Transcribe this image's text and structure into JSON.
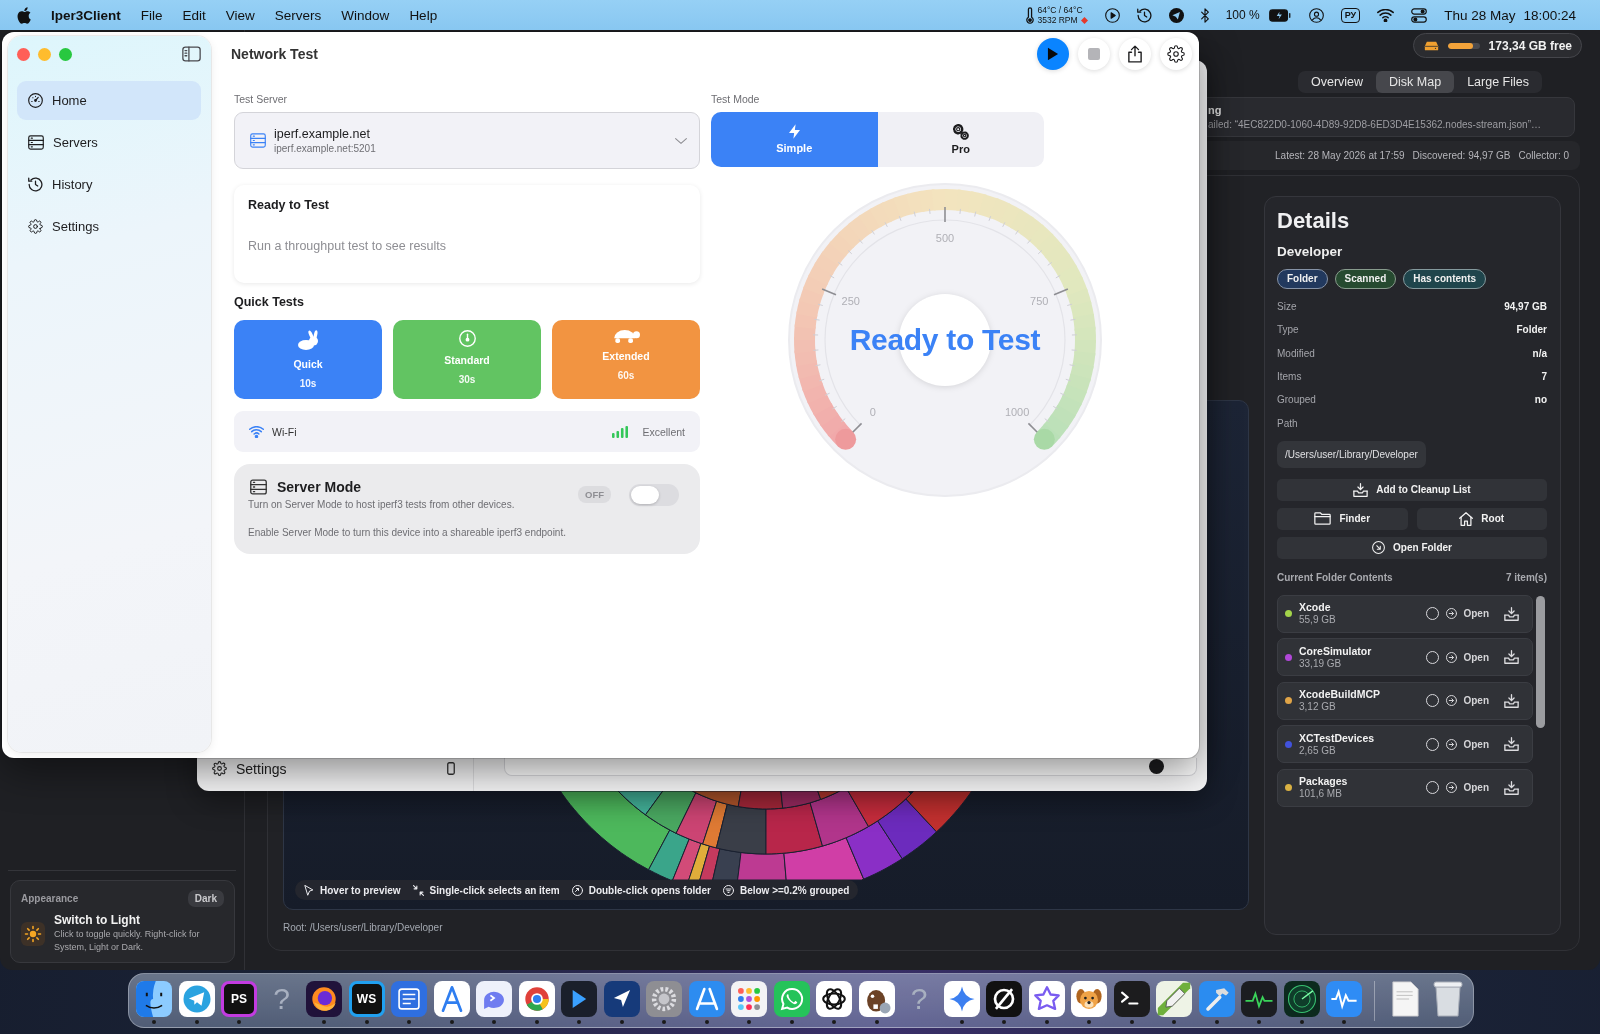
{
  "menu_bar": {
    "app_name": "Iper3Client",
    "menus": [
      "File",
      "Edit",
      "View",
      "Servers",
      "Window",
      "Help"
    ],
    "temperature": "64°C / 64°C",
    "fan_speed": "3532 RPM",
    "battery": "100 %",
    "input_source": "РУ",
    "date": "Thu 28 May",
    "time": "18:00:24"
  },
  "window": {
    "title": "Network Test"
  },
  "sidebar": {
    "items": [
      {
        "label": "Home",
        "kind": "gauge",
        "selected": true
      },
      {
        "label": "Servers",
        "kind": "servers",
        "selected": false
      },
      {
        "label": "History",
        "kind": "history",
        "selected": false
      },
      {
        "label": "Settings",
        "kind": "settings",
        "selected": false
      }
    ]
  },
  "toolbar": {
    "buttons": [
      {
        "kind": "start",
        "disabled": false
      },
      {
        "kind": "stop",
        "disabled": true
      },
      {
        "kind": "share",
        "disabled": false
      },
      {
        "kind": "settings",
        "disabled": false
      }
    ]
  },
  "test_server": {
    "label": "Test Server",
    "name": "iperf.example.net",
    "address": "iperf.example.net:5201"
  },
  "status_card": {
    "title": "Ready to Test",
    "message": "Run a throughput test to see results"
  },
  "quick_tests": {
    "title": "Quick Tests",
    "tests": [
      {
        "name": "Quick",
        "duration": "10s",
        "kind": "rabbit",
        "color": "#3b82f6"
      },
      {
        "name": "Standard",
        "duration": "30s",
        "kind": "gauge",
        "color": "#62c462"
      },
      {
        "name": "Extended",
        "duration": "60s",
        "kind": "turtle",
        "color": "#f29441"
      }
    ]
  },
  "connection": {
    "type": "Wi-Fi",
    "quality": "Excellent"
  },
  "server_mode": {
    "title": "Server Mode",
    "description": "Turn on Server Mode to host iperf3 tests from other devices.",
    "state": "OFF",
    "on": false,
    "note": "Enable Server Mode to turn this device into a shareable iperf3 endpoint."
  },
  "test_mode": {
    "label": "Test Mode",
    "options": [
      {
        "label": "Simple",
        "kind": "bolt",
        "selected": true
      },
      {
        "label": "Pro",
        "kind": "gears",
        "selected": false
      }
    ]
  },
  "gauge": {
    "ticks": [
      "0",
      "250",
      "500",
      "750",
      "1000"
    ],
    "status": "Ready to Test"
  },
  "settings_window": {
    "sidebar_item": "Settings"
  },
  "disk_app": {
    "free_space": {
      "text": "173,34 GB free",
      "level": 0.8
    },
    "tabs": [
      {
        "label": "Overview",
        "selected": false
      },
      {
        "label": "Disk Map",
        "selected": true
      },
      {
        "label": "Large Files",
        "selected": false
      }
    ],
    "error_banner": {
      "title": "ng",
      "message": "ailed: “4EC822D0-1060-4D89-92D8-6ED3D4E15362.nodes-stream.json”…"
    },
    "scan_stats": [
      "Latest: 28 May 2026 at 17:59",
      "Discovered: 94,97 GB",
      "Collector: 0"
    ],
    "hints": [
      {
        "kind": "pointer",
        "text": "Hover to preview"
      },
      {
        "kind": "select",
        "text": "Single-click selects an item"
      },
      {
        "kind": "open",
        "text": "Double-click opens folder"
      },
      {
        "kind": "group",
        "text": "Below >=0.2% grouped"
      }
    ],
    "root_path": "Root: /Users/user/Library/Developer",
    "details": {
      "title": "Details",
      "name": "Developer",
      "tags": [
        {
          "label": "Folder",
          "color": "#22395e"
        },
        {
          "label": "Scanned",
          "color": "#264a30"
        },
        {
          "label": "Has contents",
          "color": "#1f454c"
        }
      ],
      "properties": [
        {
          "label": "Size",
          "value": "94,97 GB"
        },
        {
          "label": "Type",
          "value": "Folder"
        },
        {
          "label": "Modified",
          "value": "n/a"
        },
        {
          "label": "Items",
          "value": "7"
        },
        {
          "label": "Grouped",
          "value": "no"
        }
      ],
      "path_label": "Path",
      "path": "/Users/user/Library/Developer",
      "actions": [
        {
          "label": "Add to Cleanup List",
          "kind": "cleanup"
        },
        {
          "label": "Finder",
          "kind": "finder"
        },
        {
          "label": "Root",
          "kind": "root"
        },
        {
          "label": "Open Folder",
          "kind": "open"
        }
      ],
      "contents_title": "Current Folder Contents",
      "contents_count": "7 item(s)",
      "contents": [
        {
          "name": "Xcode",
          "size": "55,9 GB",
          "color": "#a3d44a",
          "checked": false,
          "action": "Open"
        },
        {
          "name": "CoreSimulator",
          "size": "33,19 GB",
          "color": "#b147d8",
          "checked": false,
          "action": "Open"
        },
        {
          "name": "XcodeBuildMCP",
          "size": "3,12 GB",
          "color": "#e0a447",
          "checked": false,
          "action": "Open"
        },
        {
          "name": "XCTestDevices",
          "size": "2,65 GB",
          "color": "#4152dc",
          "checked": false,
          "action": "Open"
        },
        {
          "name": "Packages",
          "size": "101,6 MB",
          "color": "#d9b143",
          "checked": false,
          "action": "Open"
        }
      ]
    },
    "appearance": {
      "title": "Appearance",
      "mode": "Dark",
      "action": "Switch to Light",
      "hint": "Click to toggle quickly. Right-click for System, Light or Dark."
    }
  },
  "dock": {
    "apps": [
      {
        "kind": "face",
        "running": true
      },
      {
        "kind": "plane",
        "running": true
      },
      {
        "kind": "letters",
        "label": "PS",
        "color": "#c23be0",
        "running": true
      },
      {
        "kind": "unknown",
        "label": "?",
        "running": false
      },
      {
        "kind": "flame",
        "running": true
      },
      {
        "kind": "letters",
        "label": "WS",
        "color": "#20a0f0",
        "running": true
      },
      {
        "kind": "lines",
        "running": true
      },
      {
        "kind": "compass",
        "running": true
      },
      {
        "kind": "bubble",
        "running": true
      },
      {
        "kind": "wheel",
        "running": true
      },
      {
        "kind": "chevron",
        "running": true
      },
      {
        "kind": "arrow",
        "running": true
      },
      {
        "kind": "gear",
        "running": true
      },
      {
        "kind": "sticks",
        "running": true
      },
      {
        "kind": "grid",
        "running": true
      },
      {
        "kind": "phone",
        "running": true
      },
      {
        "kind": "knot",
        "running": true
      },
      {
        "kind": "beaver",
        "running": true
      },
      {
        "kind": "unknown",
        "label": "?",
        "running": false
      },
      {
        "kind": "sparkle",
        "running": true
      },
      {
        "kind": "slashed",
        "running": true
      },
      {
        "kind": "star",
        "running": true
      },
      {
        "kind": "dog",
        "running": true
      },
      {
        "kind": "terminal",
        "running": true
      },
      {
        "kind": "pen",
        "running": true
      },
      {
        "kind": "hammer",
        "running": true
      },
      {
        "kind": "pulse",
        "running": true
      },
      {
        "kind": "radar",
        "running": true
      },
      {
        "kind": "wave",
        "running": true
      }
    ],
    "stacks": [
      {
        "kind": "document",
        "running": false
      },
      {
        "kind": "trash",
        "running": false
      }
    ]
  }
}
